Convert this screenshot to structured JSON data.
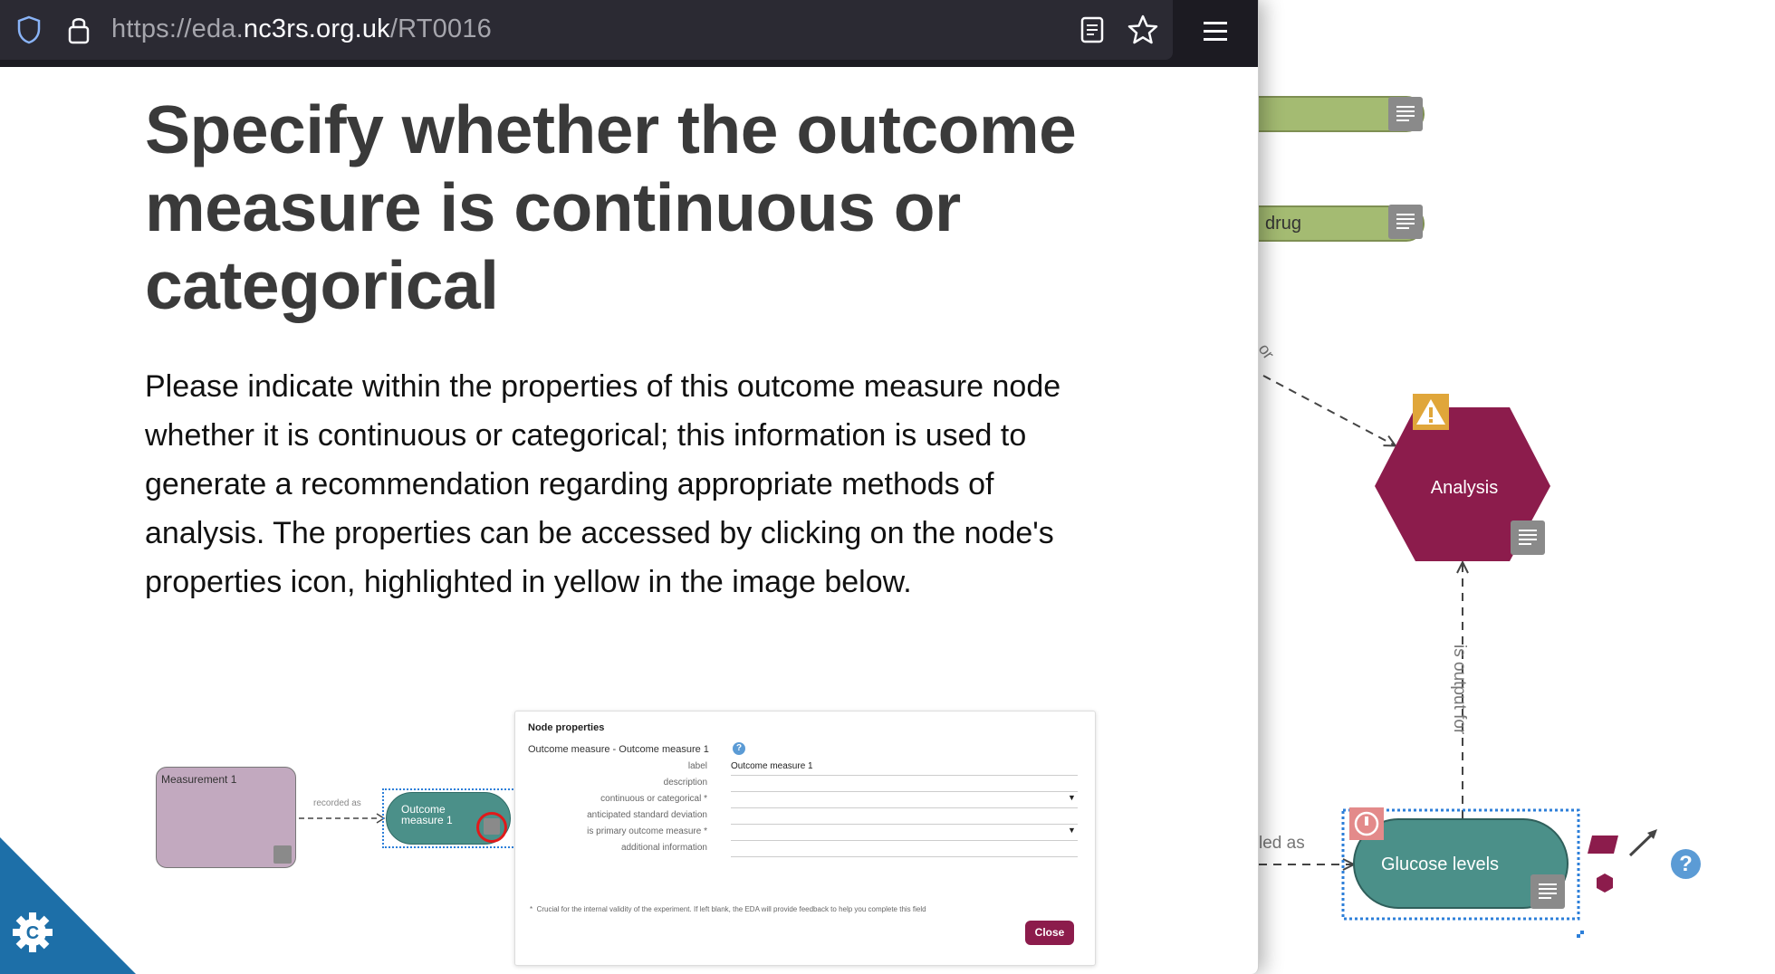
{
  "browser": {
    "url_prefix": "https://eda.",
    "url_domain": "nc3rs.org.uk",
    "url_path": "/RT0016",
    "shield_icon": "shield-icon",
    "lock_icon": "lock-icon",
    "reader_icon": "reader-view-icon",
    "bookmark_icon": "star-icon",
    "menu_icon": "hamburger-menu-icon"
  },
  "article": {
    "title": "Specify whether the outcome measure is continuous or categorical",
    "body": "Please indicate within the properties of this outcome measure node whether it is continuous or categorical; this information is used to generate a recommendation regarding appropriate methods of analysis. The properties can be accessed by clicking on the node's properties icon, highlighted in yellow in the image below."
  },
  "figure": {
    "measurement_label": "Measurement 1",
    "edge_label": "recorded as",
    "outcome_label": "Outcome measure 1",
    "dialog": {
      "title": "Node properties",
      "subtitle": "Outcome measure - Outcome measure 1",
      "rows": [
        {
          "label": "label",
          "value": "Outcome measure 1"
        },
        {
          "label": "description",
          "value": ""
        },
        {
          "label": "continuous or categorical",
          "value": ""
        },
        {
          "label": "anticipated standard deviation",
          "value": ""
        },
        {
          "label": "is primary outcome measure",
          "value": ""
        },
        {
          "label": "additional information",
          "value": ""
        }
      ],
      "footnote": "Crucial for the internal validity of the experiment. If left blank, the EDA will provide feedback to help you complete this field",
      "close_label": "Close"
    }
  },
  "diagram": {
    "node_drug_label": "drug",
    "node_analysis_label": "Analysis",
    "node_glucose_label": "Glucose levels",
    "edge_output_label": "is output for",
    "edge_recorded_label": "led as",
    "edge_partial_label": "or",
    "accent_maroon": "#8c1c4c",
    "accent_teal": "#4b9089",
    "accent_green": "#a4bb72"
  }
}
